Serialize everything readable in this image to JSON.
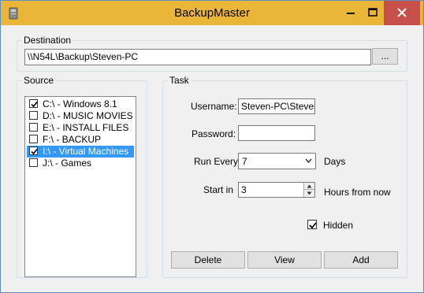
{
  "window": {
    "title": "BackupMaster"
  },
  "destination": {
    "group_label": "Destination",
    "path": "\\\\N54L\\Backup\\Steven-PC",
    "browse_label": "..."
  },
  "source": {
    "group_label": "Source",
    "items": [
      {
        "label": "C:\\ - Windows 8.1",
        "checked": true,
        "selected": false
      },
      {
        "label": "D:\\ - MUSIC MOVIES",
        "checked": false,
        "selected": false
      },
      {
        "label": "E:\\ - INSTALL FILES",
        "checked": false,
        "selected": false
      },
      {
        "label": "F:\\ - BACKUP",
        "checked": false,
        "selected": false
      },
      {
        "label": "I:\\ - Virtual Machines",
        "checked": true,
        "selected": true
      },
      {
        "label": "J:\\ - Games",
        "checked": false,
        "selected": false
      }
    ]
  },
  "task": {
    "group_label": "Task",
    "username_label": "Username:",
    "username_value": "Steven-PC\\Steven",
    "password_label": "Password:",
    "password_value": "",
    "run_every_label": "Run Every",
    "run_every_value": "7",
    "days_label": "Days",
    "start_in_label": "Start in",
    "start_in_value": "3",
    "hours_label": "Hours from now",
    "hidden_label": "Hidden",
    "hidden_checked": true
  },
  "buttons": {
    "delete_label": "Delete",
    "view_label": "View",
    "add_label": "Add"
  },
  "colors": {
    "titlebar": "#e9b63a",
    "close": "#c7504b",
    "selection": "#3399ff"
  }
}
